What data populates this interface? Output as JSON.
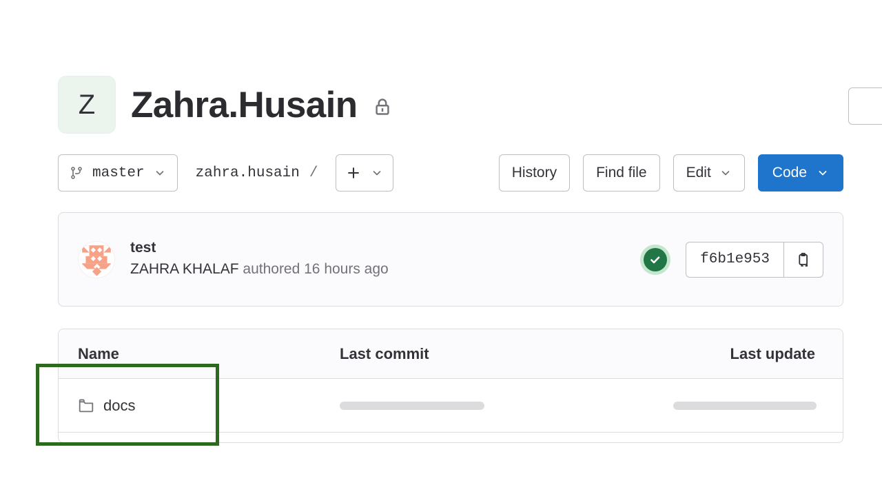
{
  "repository": {
    "avatar_initial": "Z",
    "name": "Zahra.Husain",
    "visibility_icon": "lock-icon"
  },
  "toolbar": {
    "branch": {
      "icon": "branch-icon",
      "label": "master",
      "chevron": "chevron-down-icon"
    },
    "breadcrumb": {
      "root": "zahra.husain",
      "separator": "/"
    },
    "add": {
      "plus": "+",
      "chevron": "chevron-down-icon"
    },
    "history_label": "History",
    "find_file_label": "Find file",
    "edit_label": "Edit",
    "edit_chevron": "chevron-down-icon",
    "code_label": "Code",
    "code_chevron": "chevron-down-icon",
    "code_button_color": "#1f75cb"
  },
  "commit": {
    "avatar_icon": "identicon-avatar",
    "message": "test",
    "author": "ZAHRA KHALAF",
    "meta": "authored 16 hours ago",
    "pipeline_status_icon": "check-circle-icon",
    "pipeline_status_color": "#217645",
    "sha": "f6b1e953",
    "copy_icon": "clipboard-copy-icon"
  },
  "file_table": {
    "headers": {
      "name": "Name",
      "last_commit": "Last commit",
      "last_update": "Last update"
    },
    "rows": [
      {
        "icon": "folder-icon",
        "name": "docs",
        "last_commit": "",
        "last_update": ""
      }
    ]
  },
  "annotation": {
    "target": "docs",
    "color": "#2d6a1f"
  }
}
